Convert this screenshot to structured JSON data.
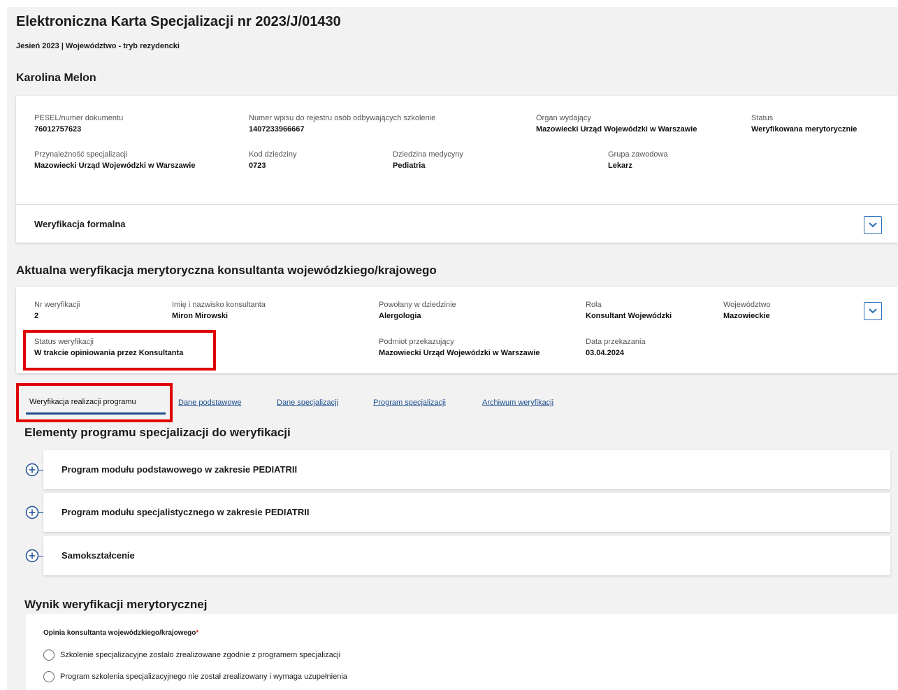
{
  "header": {
    "title": "Elektroniczna Karta Specjalizacji nr 2023/J/01430",
    "subtitle": "Jesień 2023 | Województwo - tryb rezydencki",
    "person_name": "Karolina Melon"
  },
  "info_card": {
    "pesel_label": "PESEL/numer dokumentu",
    "pesel_value": "76012757623",
    "registry_label": "Numer wpisu do rejestru osób odbywających szkolenie",
    "registry_value": "1407233966667",
    "issuer_label": "Organ wydający",
    "issuer_value": "Mazowiecki Urząd Wojewódzki w Warszawie",
    "status_label": "Status",
    "status_value": "Weryfikowana merytorycznie",
    "membership_label": "Przynależność specjalizacji",
    "membership_value": "Mazowiecki Urząd Wojewódzki w Warszawie",
    "domain_code_label": "Kod dziedziny",
    "domain_code_value": "0723",
    "medicine_domain_label": "Dziedzina medycyny",
    "medicine_domain_value": "Pediatria",
    "group_label": "Grupa zawodowa",
    "group_value": "Lekarz",
    "formal_verification_label": "Weryfikacja formalna"
  },
  "verification": {
    "section_title": "Aktualna weryfikacja merytoryczna konsultanta wojewódzkiego/krajowego",
    "nr_label": "Nr weryfikacji",
    "nr_value": "2",
    "consultant_label": "Imię i nazwisko konsultanta",
    "consultant_value": "Miron Mirowski",
    "appointed_label": "Powołany w dziedzinie",
    "appointed_value": "Alergologia",
    "role_label": "Rola",
    "role_value": "Konsultant Wojewódzki",
    "voivodeship_label": "Województwo",
    "voivodeship_value": "Mazowieckie",
    "status_label": "Status weryfikacji",
    "status_value": "W trakcie opiniowania przez Konsultanta",
    "transferring_label": "Podmiot przekazujący",
    "transferring_value": "Mazowiecki Urząd Wojewódzki w Warszawie",
    "date_label": "Data przekazania",
    "date_value": "03.04.2024"
  },
  "tabs": [
    {
      "label": "Weryfikacja realizacji programu",
      "active": true
    },
    {
      "label": "Dane podstawowe",
      "active": false
    },
    {
      "label": "Dane specjalizacji",
      "active": false
    },
    {
      "label": "Program specjalizacji",
      "active": false
    },
    {
      "label": "Archiwum weryfikacji",
      "active": false
    }
  ],
  "program": {
    "section_title": "Elementy programu specjalizacji do weryfikacji",
    "items": [
      {
        "label": "Program modułu podstawowego w zakresie PEDIATRII"
      },
      {
        "label": "Program modułu specjalistycznego w zakresie PEDIATRII"
      },
      {
        "label": "Samokształcenie"
      }
    ]
  },
  "result": {
    "section_title": "Wynik weryfikacji merytorycznej",
    "opinion_label": "Opinia konsultanta wojewódzkiego/krajowego",
    "required_mark": "*",
    "options": [
      {
        "label": "Szkolenie specjalizacyjne zostało zrealizowane zgodnie z programem specjalizacji"
      },
      {
        "label": "Program szkolenia specjalizacyjnego nie został zrealizowany i wymaga uzupełnienia"
      }
    ]
  },
  "colors": {
    "accent": "#1d4f91",
    "highlight": "#e00000",
    "page_bg": "#f2f2f2"
  }
}
